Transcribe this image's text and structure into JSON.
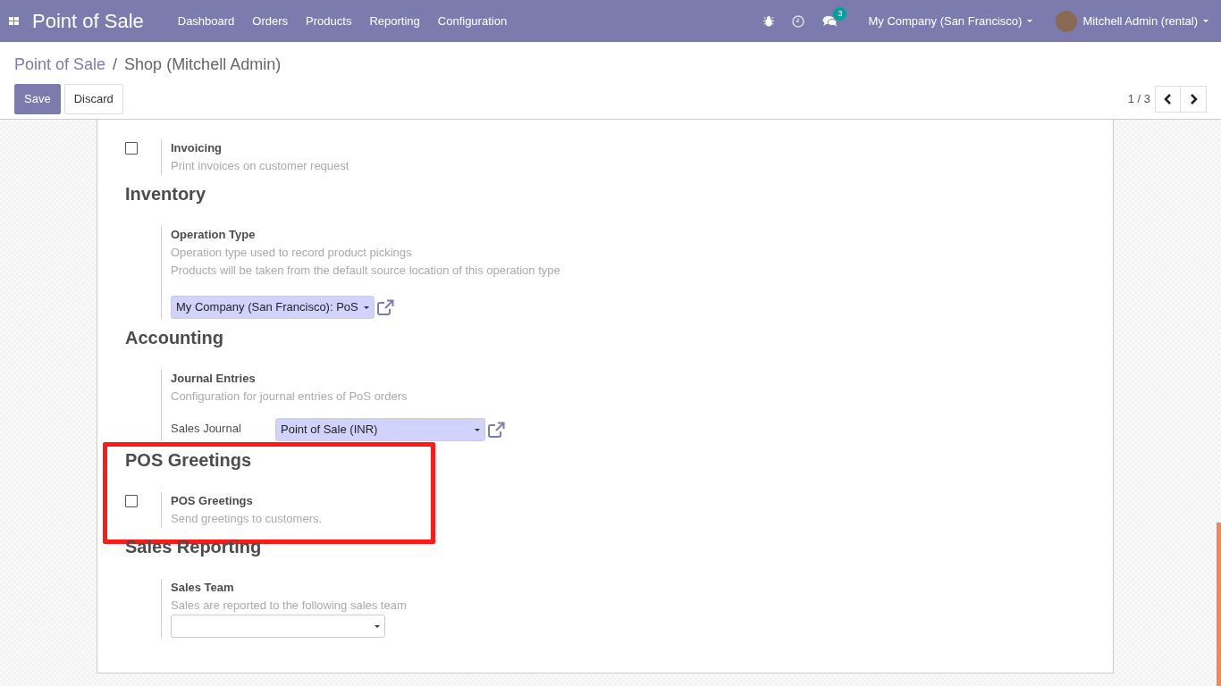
{
  "navbar": {
    "app_title": "Point of Sale",
    "menu": [
      {
        "label": "Dashboard"
      },
      {
        "label": "Orders"
      },
      {
        "label": "Products"
      },
      {
        "label": "Reporting"
      },
      {
        "label": "Configuration"
      }
    ],
    "messages_count": "3",
    "company": "My Company (San Francisco)",
    "user": "Mitchell Admin (rental)"
  },
  "breadcrumb": {
    "parent": "Point of Sale",
    "separator": "/",
    "current": "Shop (Mitchell Admin)"
  },
  "buttons": [
    {
      "label": "Save",
      "kind": "primary"
    },
    {
      "label": "Discard",
      "kind": "secondary"
    }
  ],
  "pager": {
    "value": "1 / 3"
  },
  "sections": [
    {
      "settings": [
        {
          "kind": "checkbox",
          "checked": false,
          "label": "Invoicing",
          "descriptions": [
            "Print invoices on customer request"
          ]
        }
      ]
    },
    {
      "title": "Inventory",
      "settings": [
        {
          "kind": "field",
          "label": "Operation Type",
          "descriptions": [
            "Operation type used to record product pickings",
            "Products will be taken from the default source location of this operation type"
          ],
          "fields": [
            {
              "value": "My Company (San Francisco): PoS",
              "required": true,
              "external_link": true
            }
          ]
        }
      ]
    },
    {
      "title": "Accounting",
      "settings": [
        {
          "kind": "field",
          "label": "Journal Entries",
          "descriptions": [
            "Configuration for journal entries of PoS orders"
          ],
          "fields": [
            {
              "label": "Sales Journal",
              "value": "Point of Sale (INR)",
              "required": true,
              "external_link": true
            }
          ]
        }
      ]
    },
    {
      "title": "POS Greetings",
      "highlighted": true,
      "settings": [
        {
          "kind": "checkbox",
          "checked": false,
          "label": "POS Greetings",
          "descriptions": [
            "Send greetings to customers."
          ]
        }
      ]
    },
    {
      "title": "Sales Reporting",
      "settings": [
        {
          "kind": "field",
          "label": "Sales Team",
          "descriptions": [
            "Sales are reported to the following sales team"
          ],
          "fields": [
            {
              "required": false,
              "external_link": false
            }
          ]
        }
      ]
    }
  ]
}
